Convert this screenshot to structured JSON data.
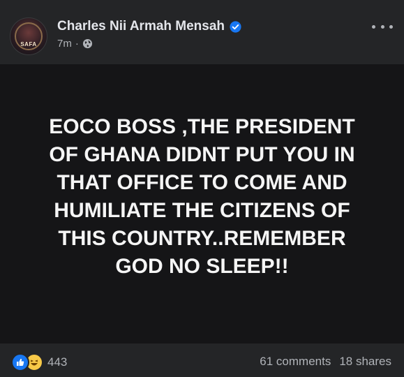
{
  "post": {
    "author": "Charles Nii Armah Mensah",
    "timestamp": "7m",
    "separator": "·",
    "verified_icon": "verified-badge-icon",
    "privacy_icon": "globe-icon",
    "more_icon": "more-options-icon",
    "avatar_text": "SAFA",
    "body_text": "EOCO BOSS ,THE PRESIDENT\nOF GHANA DIDNT PUT YOU IN\nTHAT OFFICE TO COME AND\nHUMILIATE THE CITIZENS OF\nTHIS COUNTRY..REMEMBER\nGOD NO SLEEP!!"
  },
  "footer": {
    "reaction_icons": [
      "like-icon",
      "haha-icon"
    ],
    "reaction_count": "443",
    "comments": "61 comments",
    "shares": "18 shares"
  },
  "colors": {
    "accent": "#1877f2",
    "post_background": "#151517",
    "header_background": "#242527"
  }
}
